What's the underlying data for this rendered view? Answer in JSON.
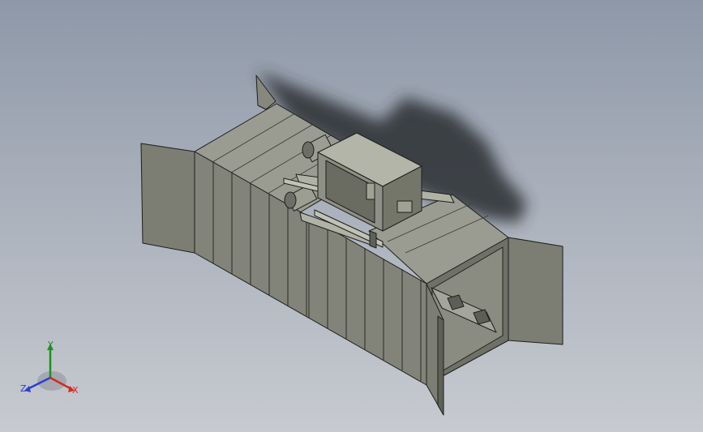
{
  "viewport": {
    "background_top": "#8e98a8",
    "background_bottom": "#c7cad0",
    "model_color": "#8d8f84",
    "edge_color": "#1e1f1b",
    "shadow_color": "#2c2f33"
  },
  "triad": {
    "x_label": "X",
    "y_label": "Y",
    "z_label": "Z",
    "x_color": "#d22b1e",
    "y_color": "#1f8f1f",
    "z_color": "#2a3fd6"
  }
}
